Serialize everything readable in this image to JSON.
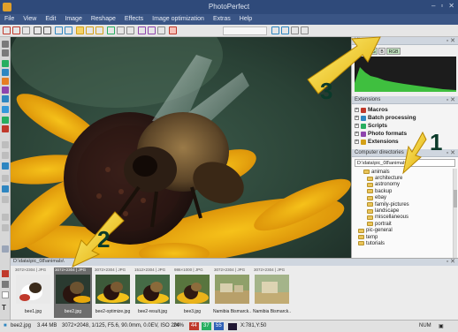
{
  "window": {
    "title": "PhotoPerfect",
    "controls": [
      "–",
      "▫",
      "✕"
    ]
  },
  "menu": [
    "File",
    "View",
    "Edit",
    "Image",
    "Reshape",
    "Effects",
    "Image optimization",
    "Extras",
    "Help"
  ],
  "histogram": {
    "title": "Histogram",
    "channels": [
      "L",
      "R",
      "G",
      "B",
      "RGB"
    ],
    "active_channels": [
      2,
      4
    ]
  },
  "extensions": {
    "title": "Extensions",
    "items": [
      "Macros",
      "Batch processing",
      "Scripts",
      "Photo formats",
      "Extensions"
    ],
    "icon_colors": [
      "#c0392b",
      "#2e86c1",
      "#27ae60",
      "#8e44ad",
      "#d4a017"
    ]
  },
  "directories": {
    "title": "Computer directories",
    "path": "D:\\data\\pic_08\\animals",
    "folders": [
      "animals",
      "architecture",
      "astronomy",
      "backup",
      "ebay",
      "family-pictures",
      "landscape",
      "miscellaneous",
      "portrait",
      "pic-general",
      "temp",
      "tutorials"
    ]
  },
  "browser": {
    "path": "D:\\data\\pic_08\\animals\\",
    "thumbnails": [
      {
        "info": "3072×2304 | JPG",
        "name": "bee1.jpg"
      },
      {
        "info": "3072×2304 | JPG",
        "name": "bee2.jpg"
      },
      {
        "info": "3072×2304 | JPG",
        "name": "bee2-optimize.jpg"
      },
      {
        "info": "1512×2304 | JPG",
        "name": "bee2-result.jpg"
      },
      {
        "info": "986×1000 | JPG",
        "name": "bee3.jpg"
      },
      {
        "info": "3072×2304 | JPG",
        "name": "Namibia Bismarck..."
      },
      {
        "info": "3072×2304 | JPG",
        "name": "Namibia Bismarck..."
      }
    ],
    "selected_index": 1
  },
  "status": {
    "file": "bee2.jpg",
    "size": "3.44 MB",
    "details": "3072×2048, 1/125, F5.6, 90.0mm, 0.0EV, ISO 200",
    "zoom": "24%",
    "r": "44",
    "g": "37",
    "b": "55",
    "coords": "X:781,Y:50",
    "num": "NUM"
  },
  "annotations": [
    "1",
    "2",
    "3"
  ]
}
